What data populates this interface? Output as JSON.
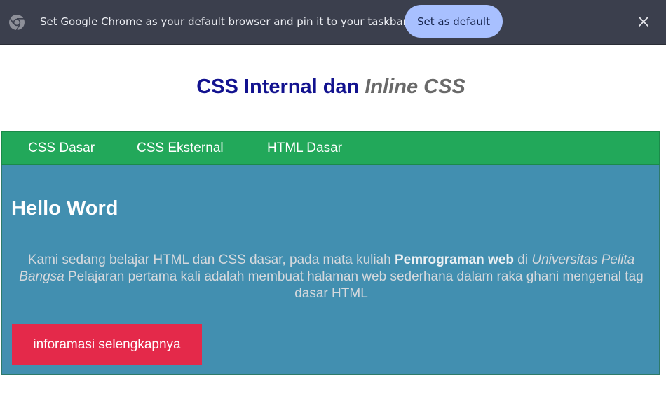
{
  "infobar": {
    "message": "Set Google Chrome as your default browser and pin it to your taskbar",
    "button_label": "Set as default",
    "icon": "chrome-icon",
    "close_icon": "close-icon",
    "background": "#3b3f4d",
    "button_color": "#a8c0ff"
  },
  "page": {
    "title_part1": "CSS Internal dan ",
    "title_part2": "Inline CSS",
    "title_color": "#12128f"
  },
  "nav": {
    "background": "#22a85a",
    "items": [
      {
        "label": "CSS Dasar"
      },
      {
        "label": "CSS Eksternal"
      },
      {
        "label": "HTML Dasar"
      }
    ]
  },
  "hero": {
    "background": "#428fb0",
    "heading": "Hello Word",
    "text_1": "Kami sedang belajar HTML dan CSS dasar, pada mata kuliah ",
    "bold": "Pemrograman web",
    "text_2": " di ",
    "italic": "Universitas Pelita Bangsa",
    "text_3": " Pelajaran pertama kali adalah membuat halaman web sederhana dalam raka ghani mengenal tag dasar HTML",
    "button_label": "inforamasi selengkapnya",
    "button_color": "#e4294a"
  }
}
